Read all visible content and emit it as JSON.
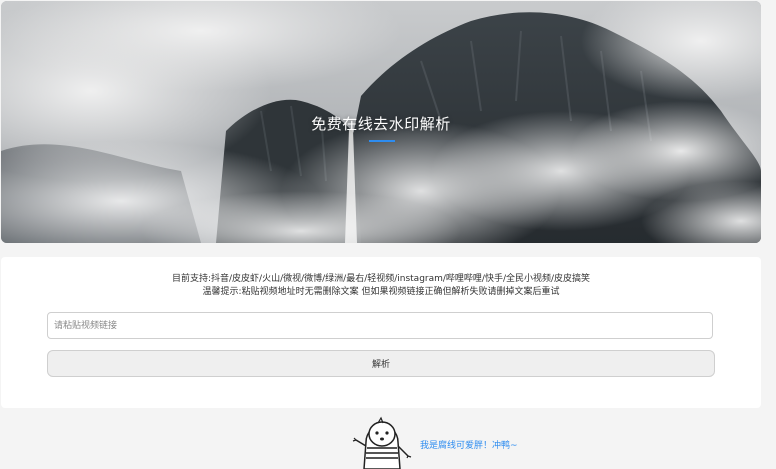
{
  "hero": {
    "title": "免费在线去水印解析"
  },
  "panel": {
    "support_text": "目前支持:抖音/皮皮虾/火山/微视/微博/绿洲/最右/轻视频/instagram/哔哩哔哩/快手/全民小视频/皮皮搞笑",
    "tip_text": "温馨提示:粘贴视频地址时无需删除文案 但如果视频链接正确但解析失败请删掉文案后重试",
    "input": {
      "placeholder": "请粘贴视频链接",
      "value": ""
    },
    "parse_button_label": "解析"
  },
  "footer": {
    "mascot_icon": "cartoon-mascot-icon",
    "mascot_text": "我是腐线可爱胖！冲鸭~"
  },
  "colors": {
    "accent": "#2d8cf0",
    "page_background": "#f4f4f4",
    "panel_background": "#ffffff"
  }
}
